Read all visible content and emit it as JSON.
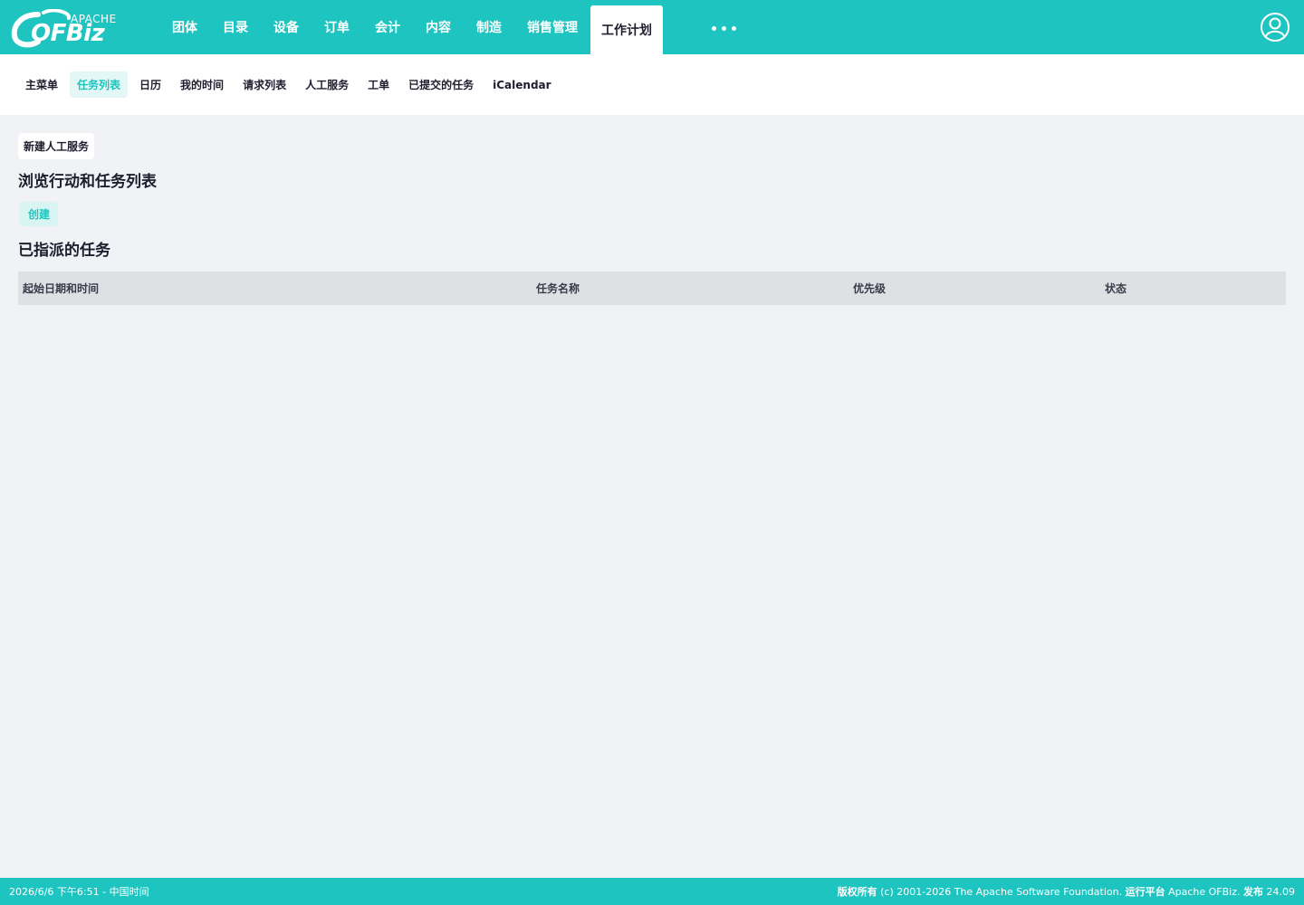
{
  "brand": {
    "apache": "APACHE",
    "name": "OFBiz"
  },
  "main_nav": [
    {
      "label": "团体"
    },
    {
      "label": "目录"
    },
    {
      "label": "设备"
    },
    {
      "label": "订单"
    },
    {
      "label": "会计"
    },
    {
      "label": "内容"
    },
    {
      "label": "制造"
    },
    {
      "label": "销售管理"
    },
    {
      "label": "工作计划",
      "active": true
    }
  ],
  "sub_nav": [
    {
      "label": "主菜单"
    },
    {
      "label": "任务列表",
      "active": true
    },
    {
      "label": "日历"
    },
    {
      "label": "我的时间"
    },
    {
      "label": "请求列表"
    },
    {
      "label": "人工服务"
    },
    {
      "label": "工单"
    },
    {
      "label": "已提交的任务"
    },
    {
      "label": "iCalendar"
    }
  ],
  "content": {
    "new_button": "新建人工服务",
    "browse_title": "浏览行动和任务列表",
    "create_button": "创建",
    "assigned_title": "已指派的任务",
    "table_headers": [
      "起始日期和时间",
      "任务名称",
      "优先级",
      "状态"
    ]
  },
  "footer": {
    "datetime": "2026/6/6 下午6:51 - 中国时间",
    "copyright_label": "版权所有",
    "copyright_text": "(c) 2001-2026 The Apache Software Foundation.",
    "powered_label": "运行平台",
    "powered_text": "Apache OFBiz.",
    "release_label": "发布",
    "release_version": "24.09"
  },
  "colors": {
    "accent": "#1ec5c0",
    "background": "#f0f2f5"
  },
  "icons": {
    "user": "user-circle-icon",
    "more": "more-dots-icon"
  }
}
